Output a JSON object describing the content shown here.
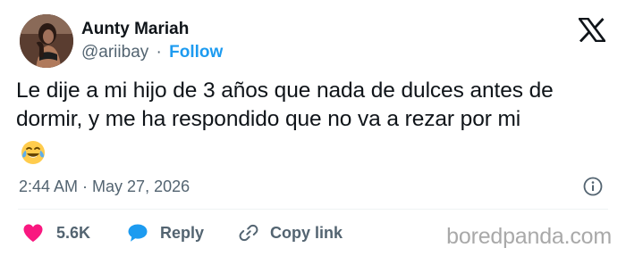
{
  "author": {
    "name": "Aunty Mariah",
    "handle": "@ariibay",
    "separator": "·",
    "follow_label": "Follow"
  },
  "tweet": {
    "text": "Le dije a mi hijo de 3 años que nada de dulces antes de dormir, y me ha respondido que no va a rezar por mi",
    "emoji": "😂",
    "timestamp": "2:44 AM · May 27, 2026"
  },
  "actions": {
    "likes_count": "5.6K",
    "reply_label": "Reply",
    "copy_link_label": "Copy link"
  },
  "icons": {
    "brand": "x-logo-icon",
    "info": "info-icon",
    "like": "heart-icon",
    "reply": "speech-bubble-icon",
    "copy": "link-icon"
  },
  "colors": {
    "follow": "#1d9bf0",
    "like": "#f91880",
    "reply": "#1d9bf0",
    "muted": "#536471",
    "text": "#0f1419",
    "watermark": "#a9a9a9"
  },
  "watermark": "boredpanda.com"
}
